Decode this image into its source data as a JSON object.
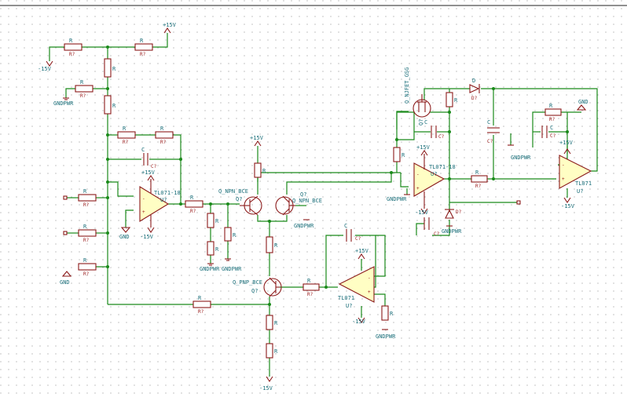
{
  "schematic": {
    "net_labels": {
      "pos15": "+15V",
      "neg15": "-15V",
      "gnd": "GND",
      "gndpwr": "GNDPWR"
    },
    "opamps": [
      {
        "part": "TL071-18",
        "ref": "U?"
      },
      {
        "part": "TL071-18",
        "ref": "U?"
      },
      {
        "part": "TL071",
        "ref": "U?"
      },
      {
        "part": "TL071",
        "ref": "U?"
      }
    ],
    "transistors": [
      {
        "part": "Q_NPN_BCE",
        "ref": "Q?"
      },
      {
        "part": "Q_NPN_BCE",
        "ref": "Q?"
      },
      {
        "part": "Q_PNP_BCE",
        "ref": "Q?"
      },
      {
        "part": "Q_NJFET_GSG",
        "ref": "Q?"
      }
    ],
    "passives": {
      "resistor": "R",
      "resistor_ref": "R?",
      "capacitor": "C",
      "capacitor_ref": "C?",
      "diode": "D",
      "diode_ref": "D?"
    }
  },
  "colors": {
    "wire": "#1a8a1a",
    "component": "#8b1a1a",
    "label": "#1b6f7a",
    "opamp_fill": "#fffec4",
    "grid_dot": "#9a9a9a"
  }
}
